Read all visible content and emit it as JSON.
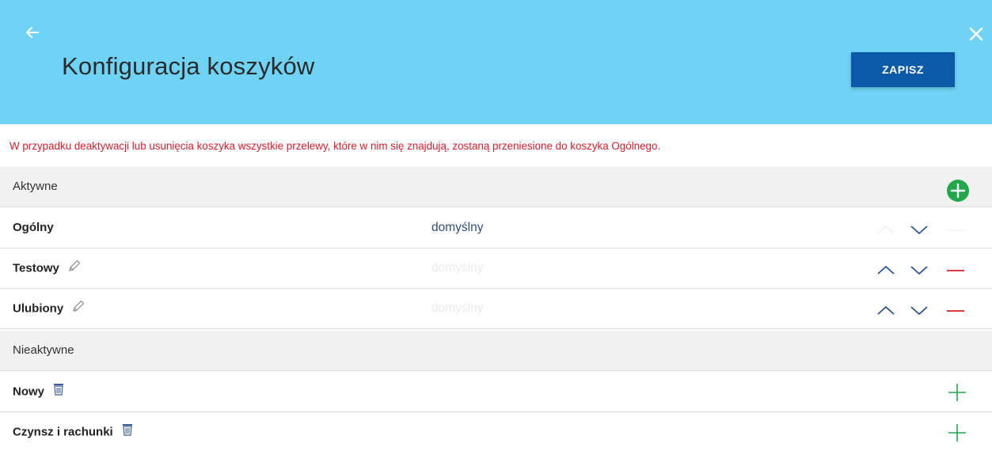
{
  "header": {
    "title": "Konfiguracja koszyków",
    "save_label": "ZAPISZ",
    "background_color": "#6fd3f5",
    "save_color": "#0b5aa7"
  },
  "warning": "W przypadku deaktywacji lub usunięcia koszyka wszystkie przelewy, które w nim się znajdują, zostaną przeniesione do koszyka Ogólnego.",
  "sections": {
    "active": {
      "label": "Aktywne",
      "rows": [
        {
          "name": "Ogólny",
          "status": "domyślny",
          "is_default": true,
          "editable": false,
          "can_move_up": false,
          "can_move_down": true,
          "can_remove": false
        },
        {
          "name": "Testowy",
          "status": "domyślny",
          "is_default": false,
          "editable": true,
          "can_move_up": true,
          "can_move_down": true,
          "can_remove": true
        },
        {
          "name": "Ulubiony",
          "status": "domyślny",
          "is_default": false,
          "editable": true,
          "can_move_up": true,
          "can_move_down": true,
          "can_remove": true
        }
      ]
    },
    "inactive": {
      "label": "Nieaktywne",
      "rows": [
        {
          "name": "Nowy",
          "deletable": true
        },
        {
          "name": "Czynsz i rachunki",
          "deletable": true
        }
      ]
    }
  },
  "icons": {
    "back": "arrow-left-icon",
    "close": "close-icon",
    "add_active": "plus-circle-icon",
    "edit": "pencil-icon",
    "delete": "trash-icon",
    "move_up": "chevron-up-icon",
    "move_down": "chevron-down-icon",
    "remove": "minus-icon",
    "activate": "plus-icon"
  },
  "colors": {
    "warning": "#d91e2a",
    "default_active": "#2d4f7e",
    "default_inactive": "#eaeaea",
    "chevron": "#1f4e8c",
    "remove": "#d91e2a",
    "add": "#22a84a"
  }
}
